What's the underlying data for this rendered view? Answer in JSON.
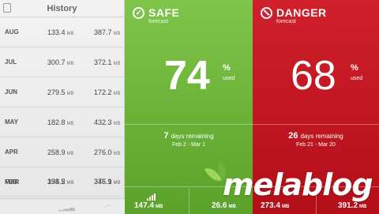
{
  "history": {
    "title": "History",
    "rows": [
      {
        "month": "AUG",
        "a": "133.4",
        "a_unit": "MB",
        "b": "387.7",
        "b_unit": "MB"
      },
      {
        "month": "JUL",
        "a": "300.7",
        "a_unit": "MB",
        "b": "372.1",
        "b_unit": "MB"
      },
      {
        "month": "JUN",
        "a": "279.5",
        "a_unit": "MB",
        "b": "172.2",
        "b_unit": "MB"
      },
      {
        "month": "MAY",
        "a": "182.8",
        "a_unit": "MB",
        "b": "432.3",
        "b_unit": "MB"
      },
      {
        "month": "APR",
        "a": "258.9",
        "a_unit": "MB",
        "b": "276.0",
        "b_unit": "MB"
      },
      {
        "month": "MAR",
        "a": "334.2",
        "a_unit": "MB",
        "b": "376.1",
        "b_unit": "MB"
      },
      {
        "month": "FEB",
        "a": "198.5",
        "a_unit": "MB",
        "b": "345.9",
        "b_unit": "MB"
      }
    ]
  },
  "safe": {
    "title": "SAFE",
    "subtitle": "forecast",
    "percent": "74",
    "percent_sign": "%",
    "used_label": "used",
    "days_num": "7",
    "days_label": "days remaining",
    "range": "Feb 2 - Mar 1",
    "foot_left_value": "147.4",
    "foot_left_unit": "MB",
    "foot_right_value": "26.6",
    "foot_right_unit": "MB"
  },
  "danger": {
    "title": "DANGER",
    "subtitle": "forecast",
    "percent": "68",
    "percent_sign": "%",
    "used_label": "used",
    "days_num": "26",
    "days_label": "days remaining",
    "range": "Feb 21 - Mar 20",
    "foot_left_value": "273.4",
    "foot_left_unit": "MB",
    "foot_right_value": "391.2",
    "foot_right_unit": "MB"
  },
  "watermark": "melablog",
  "colors": {
    "safe_green": "#6cb53a",
    "danger_red": "#c4161f"
  }
}
